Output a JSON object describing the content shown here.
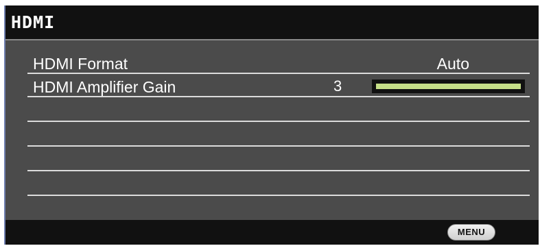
{
  "window": {
    "title": "HDMI"
  },
  "menu": {
    "items": [
      {
        "label": "HDMI Format",
        "value": "Auto"
      },
      {
        "label": "HDMI Amplifier Gain",
        "value": "3",
        "level_fraction": 1.0
      }
    ]
  },
  "footer": {
    "menu_button_label": "MENU"
  },
  "colors": {
    "panel": "#4b4b4b",
    "bar": "#111111",
    "slider_fill": "#c6df88"
  }
}
